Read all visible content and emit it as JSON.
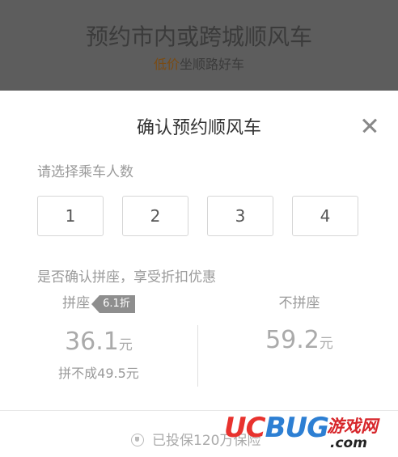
{
  "backdrop": {
    "title": "预约市内或跨城顺风车",
    "subtitle_highlight": "低价",
    "subtitle_rest": "坐顺路好车"
  },
  "dialog": {
    "title": "确认预约顺风车",
    "close_icon": "close-icon",
    "passenger_prompt": "请选择乘车人数",
    "seat_options": [
      "1",
      "2",
      "3",
      "4"
    ],
    "carpool_prompt": "是否确认拼座，享受折扣优惠",
    "carpool": {
      "label": "拼座",
      "discount_tag": "6.1折",
      "price": "36.1",
      "unit": "元",
      "fallback_note": "拼不成49.5元"
    },
    "no_carpool": {
      "label": "不拼座",
      "price": "59.2",
      "unit": "元"
    },
    "insurance_icon": "shield-icon",
    "insurance_text": "已投保120万保险"
  },
  "watermark": {
    "brand_uc": "UC",
    "brand_bug": "BUG",
    "brand_cn": "游戏网",
    "brand_domain": ".com"
  },
  "colors": {
    "backdrop": "#5d5d5d",
    "tag": "#8e8e8e",
    "watermark_red": "#e8322e",
    "watermark_blue": "#2d7fd3"
  }
}
